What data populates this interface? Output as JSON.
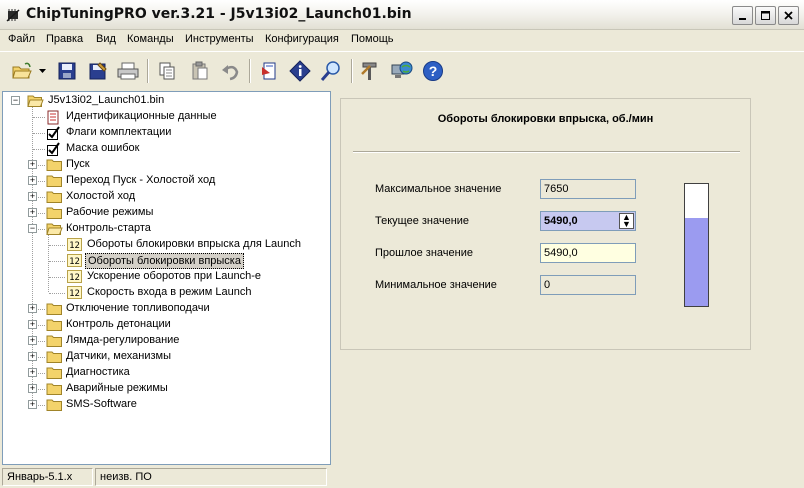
{
  "window": {
    "title": "ChipTuningPRO ver.3.21 - J5v13i02_Launch01.bin"
  },
  "menu": [
    "Файл",
    "Правка",
    "Вид",
    "Команды",
    "Инструменты",
    "Конфигурация",
    "Помощь"
  ],
  "toolbar_icons": [
    "open-folder-icon",
    "dropdown-arrow-icon",
    "save-icon",
    "save-as-icon",
    "print-icon",
    "copy-icon",
    "paste-icon",
    "undo-icon",
    "bookmark-icon",
    "info-icon",
    "search-icon",
    "tools-icon",
    "globe-computer-icon",
    "help-icon"
  ],
  "tree": {
    "root": "J5v13i02_Launch01.bin",
    "items": [
      {
        "label": "Идентификационные данные",
        "icon": "document-icon"
      },
      {
        "label": "Флаги комплектации",
        "icon": "checkbox-icon"
      },
      {
        "label": "Маска ошибок",
        "icon": "checkbox-icon"
      },
      {
        "label": "Пуск",
        "icon": "folder-icon"
      },
      {
        "label": "Переход Пуск - Холостой ход",
        "icon": "folder-icon"
      },
      {
        "label": "Холостой ход",
        "icon": "folder-icon"
      },
      {
        "label": "Рабочие режимы",
        "icon": "folder-icon"
      },
      {
        "label": "Контроль-старта",
        "icon": "folder-open-icon"
      },
      {
        "label": "Обороты блокировки впрыска для Launch",
        "icon": "number-12-icon"
      },
      {
        "label": "Обороты блокировки впрыска",
        "icon": "number-12-icon",
        "selected": true
      },
      {
        "label": "Ускорение оборотов при Launch-е",
        "icon": "number-12-icon"
      },
      {
        "label": "Скорость входа в режим Launch",
        "icon": "number-12-icon"
      },
      {
        "label": "Отключение топливоподачи",
        "icon": "folder-icon"
      },
      {
        "label": "Контроль детонации",
        "icon": "folder-icon"
      },
      {
        "label": "Лямда-регулирование",
        "icon": "folder-icon"
      },
      {
        "label": "Датчики, механизмы",
        "icon": "folder-icon"
      },
      {
        "label": "Диагностика",
        "icon": "folder-icon"
      },
      {
        "label": "Аварийные режимы",
        "icon": "folder-icon"
      },
      {
        "label": "SMS-Software",
        "icon": "folder-icon"
      }
    ]
  },
  "panel": {
    "title": "Обороты блокировки впрыска, об./мин",
    "max_label": "Максимальное значение",
    "max_value": "7650",
    "current_label": "Текущее значение",
    "current_value": "5490,0",
    "previous_label": "Прошлое значение",
    "previous_value": "5490,0",
    "min_label": "Минимальное значение",
    "min_value": "0",
    "gauge_fraction": 0.718
  },
  "status": {
    "left": "Январь-5.1.x",
    "right": "неизв. ПО"
  },
  "colors": {
    "gauge_fill": "#9b9bf0",
    "current_field_bg": "#c7c9f0",
    "previous_field_bg": "#ffffe1",
    "tree_border": "#7f9db9"
  }
}
